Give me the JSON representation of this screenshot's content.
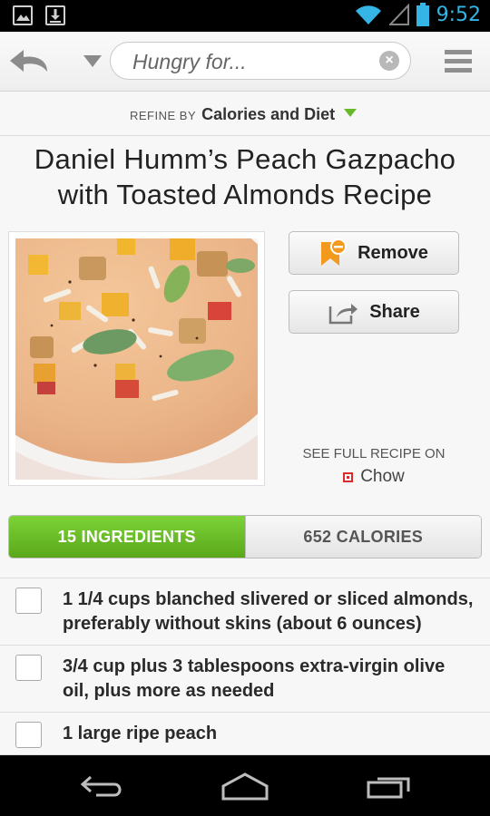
{
  "status_bar": {
    "time": "9:52",
    "icons": [
      "image-icon",
      "download-icon",
      "wifi-icon",
      "signal-icon",
      "battery-icon"
    ]
  },
  "app_bar": {
    "search_placeholder": "Hungry for...",
    "icons": [
      "back-arrow-icon",
      "dropdown-icon",
      "clear-icon",
      "menu-icon"
    ]
  },
  "refine": {
    "prefix": "REFINE BY",
    "value": "Calories and Diet"
  },
  "recipe": {
    "title": "Daniel Humm’s Peach Gazpacho with Toasted Almonds Recipe",
    "remove_label": "Remove",
    "share_label": "Share",
    "see_full": "SEE FULL RECIPE ON",
    "source": "Chow"
  },
  "tabs": {
    "ingredients": "15 INGREDIENTS",
    "calories": "652 CALORIES"
  },
  "ingredients": [
    "1 1/4 cups blanched slivered or sliced almonds, preferably without skins (about 6 ounces)",
    "3/4 cup plus 3 tablespoons extra-virgin olive oil, plus more as needed",
    "1 large ripe peach"
  ],
  "colors": {
    "accent_green": "#6ab92a",
    "status_time": "#34b5e5",
    "bookmark_orange": "#f39a1e"
  }
}
